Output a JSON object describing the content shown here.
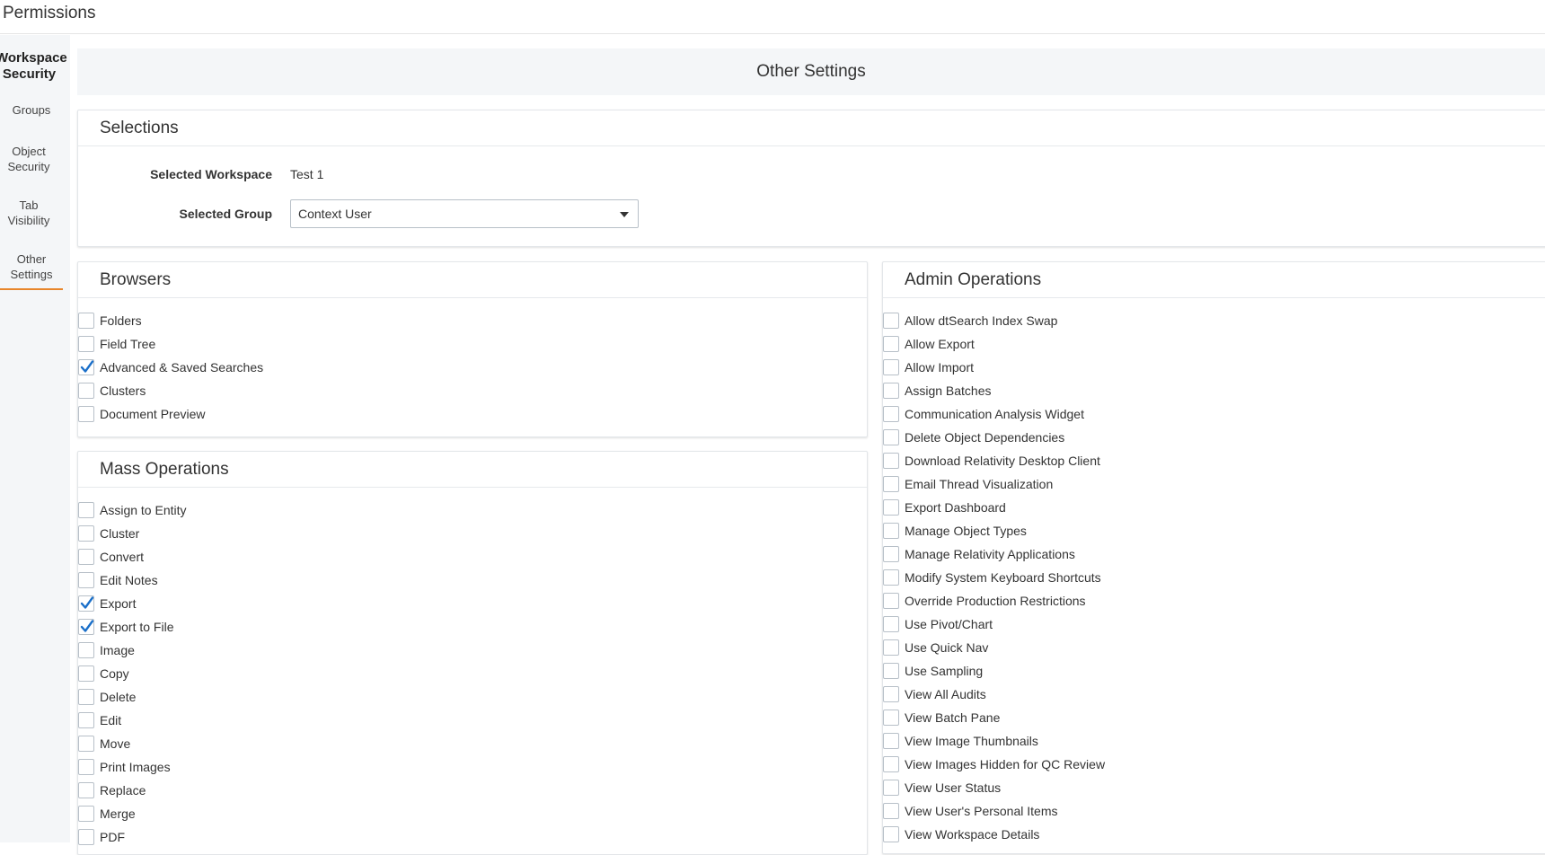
{
  "app": {
    "title": "Permissions"
  },
  "sidebar": {
    "header": "Workspace Security",
    "items": [
      {
        "label": "Groups"
      },
      {
        "label": "Object Security"
      },
      {
        "label": "Tab Visibility"
      },
      {
        "label": "Other Settings",
        "active": true
      }
    ]
  },
  "page": {
    "title": "Other Settings"
  },
  "selections": {
    "title": "Selections",
    "workspace_label": "Selected Workspace",
    "workspace_value": "Test 1",
    "group_label": "Selected Group",
    "group_value": "Context User"
  },
  "browsers": {
    "title": "Browsers",
    "items": [
      {
        "label": "Folders",
        "checked": false
      },
      {
        "label": "Field Tree",
        "checked": false
      },
      {
        "label": "Advanced & Saved Searches",
        "checked": true
      },
      {
        "label": "Clusters",
        "checked": false
      },
      {
        "label": "Document Preview",
        "checked": false
      }
    ]
  },
  "mass_operations": {
    "title": "Mass Operations",
    "items": [
      {
        "label": "Assign to Entity",
        "checked": false
      },
      {
        "label": "Cluster",
        "checked": false
      },
      {
        "label": "Convert",
        "checked": false
      },
      {
        "label": "Edit Notes",
        "checked": false
      },
      {
        "label": "Export",
        "checked": true
      },
      {
        "label": "Export to File",
        "checked": true
      },
      {
        "label": "Image",
        "checked": false
      },
      {
        "label": "Copy",
        "checked": false
      },
      {
        "label": "Delete",
        "checked": false
      },
      {
        "label": "Edit",
        "checked": false
      },
      {
        "label": "Move",
        "checked": false
      },
      {
        "label": "Print Images",
        "checked": false
      },
      {
        "label": "Replace",
        "checked": false
      },
      {
        "label": "Merge",
        "checked": false
      },
      {
        "label": "PDF",
        "checked": false
      }
    ]
  },
  "admin_operations": {
    "title": "Admin Operations",
    "items": [
      {
        "label": "Allow dtSearch Index Swap",
        "checked": false
      },
      {
        "label": "Allow Export",
        "checked": false
      },
      {
        "label": "Allow Import",
        "checked": false
      },
      {
        "label": "Assign Batches",
        "checked": false
      },
      {
        "label": "Communication Analysis Widget",
        "checked": false
      },
      {
        "label": "Delete Object Dependencies",
        "checked": false
      },
      {
        "label": "Download Relativity Desktop Client",
        "checked": false
      },
      {
        "label": "Email Thread Visualization",
        "checked": false
      },
      {
        "label": "Export Dashboard",
        "checked": false
      },
      {
        "label": "Manage Object Types",
        "checked": false
      },
      {
        "label": "Manage Relativity Applications",
        "checked": false
      },
      {
        "label": "Modify System Keyboard Shortcuts",
        "checked": false
      },
      {
        "label": "Override Production Restrictions",
        "checked": false
      },
      {
        "label": "Use Pivot/Chart",
        "checked": false
      },
      {
        "label": "Use Quick Nav",
        "checked": false
      },
      {
        "label": "Use Sampling",
        "checked": false
      },
      {
        "label": "View All Audits",
        "checked": false
      },
      {
        "label": "View Batch Pane",
        "checked": false
      },
      {
        "label": "View Image Thumbnails",
        "checked": false
      },
      {
        "label": "View Images Hidden for QC Review",
        "checked": false
      },
      {
        "label": "View User Status",
        "checked": false
      },
      {
        "label": "View User's Personal Items",
        "checked": false
      },
      {
        "label": "View Workspace Details",
        "checked": false
      }
    ]
  },
  "colors": {
    "accent": "#e8862b",
    "checkmark": "#1a6fc9",
    "header_bg": "#f4f6f8"
  },
  "icons": {
    "checkbox_checked": "checkmark-icon",
    "dropdown": "caret-down-icon"
  }
}
